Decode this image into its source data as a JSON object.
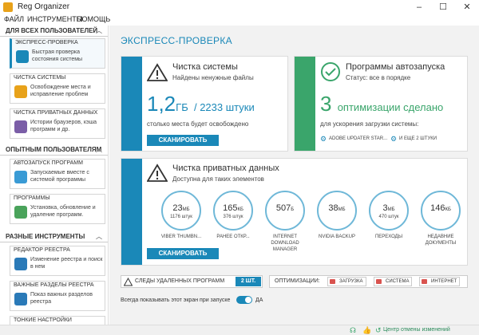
{
  "window": {
    "title": "Reg Organizer",
    "minimize": "–",
    "maximize": "☐",
    "close": "✕"
  },
  "menu": [
    "ФАЙЛ",
    "ИНСТРУМЕНТЫ",
    "ПОМОЩЬ"
  ],
  "sidebar": {
    "sections": [
      {
        "title": "ДЛЯ ВСЕХ ПОЛЬЗОВАТЕЛЕЙ"
      },
      {
        "title": "ОПЫТНЫМ ПОЛЬЗОВАТЕЛЯМ"
      },
      {
        "title": "РАЗНЫЕ ИНСТРУМЕНТЫ"
      }
    ],
    "items": [
      {
        "label": "ЭКСПРЕСС-ПРОВЕРКА",
        "desc": "Быстрая проверка состояния системы",
        "color": "#1a88b8"
      },
      {
        "label": "ЧИСТКА СИСТЕМЫ",
        "desc": "Освобождение места и исправление проблем",
        "color": "#e8a21a"
      },
      {
        "label": "ЧИСТКА ПРИВАТНЫХ ДАННЫХ",
        "desc": "Истории браузеров, кэша программ и др.",
        "color": "#7b5ea7"
      },
      {
        "label": "АВТОЗАПУСК ПРОГРАММ",
        "desc": "Запускаемые вместе с системой программы",
        "color": "#3a9bd5"
      },
      {
        "label": "ПРОГРАММЫ",
        "desc": "Установка, обновление и удаление программ.",
        "color": "#4aa35b"
      },
      {
        "label": "РЕДАКТОР РЕЕСТРА",
        "desc": "Изменение реестра и поиск в нем",
        "color": "#2a7ab8"
      },
      {
        "label": "ВАЖНЫЕ РАЗДЕЛЫ РЕЕСТРА",
        "desc": "Показ важных разделов реестра",
        "color": "#2a7ab8"
      },
      {
        "label": "ТОНКИЕ НАСТРОЙКИ",
        "desc": "",
        "color": "#888888"
      }
    ]
  },
  "main": {
    "title": "ЭКСПРЕСС-ПРОВЕРКА",
    "clean": {
      "title": "Чистка системы",
      "sub": "Найдены ненужные файлы",
      "big_num": "1,2",
      "big_unit": "ГБ",
      "big_rest": "/ 2233 штуки",
      "desc": "столько места будет освобождено",
      "button": "СКАНИРОВАТЬ"
    },
    "startup": {
      "title": "Программы автозапуска",
      "sub": "Статус: все в порядке",
      "big_num": "3",
      "big_text": "оптимизации сделано",
      "desc": "для ускорения загрузки системы:",
      "link1": "ADOBE UPDATER STAR...",
      "link2": "И ЕЩЕ 2 ШТУКИ"
    },
    "privacy": {
      "title": "Чистка приватных данных",
      "sub": "Доступна для таких элементов",
      "button": "СКАНИРОВАТЬ",
      "circles": [
        {
          "value": "23",
          "unit": "МБ",
          "count": "1176 штук",
          "label": "VIBER THUMBN..."
        },
        {
          "value": "165",
          "unit": "КБ",
          "count": "376 штук",
          "label": "РАНЕЕ ОТКР..."
        },
        {
          "value": "507",
          "unit": "Б",
          "count": "",
          "label": "INTERNET DOWNLOAD MANAGER"
        },
        {
          "value": "38",
          "unit": "МБ",
          "count": "",
          "label": "NVIDIA BACKUP"
        },
        {
          "value": "3",
          "unit": "МБ",
          "count": "470 штук",
          "label": "ПЕРЕХОДЫ"
        },
        {
          "value": "146",
          "unit": "КБ",
          "count": "",
          "label": "НЕДАВНИЕ ДОКУМЕНТЫ"
        }
      ]
    },
    "traces": {
      "label": "СЛЕДЫ УДАЛЕННЫХ ПРОГРАММ",
      "count": "2 ШТ."
    },
    "optim": {
      "label": "ОПТИМИЗАЦИИ:",
      "items": [
        "ЗАГРУЗКА",
        "СИСТЕМА",
        "ИНТЕРНЕТ"
      ]
    },
    "always": {
      "label": "Всегда показывать этот экран при запуске",
      "toggle": "ДА"
    }
  },
  "statusbar": {
    "undo": "Центр отмены изменений"
  },
  "colors": {
    "accent": "#1a88b8",
    "green": "#3aa56b",
    "red": "#d9534f"
  }
}
